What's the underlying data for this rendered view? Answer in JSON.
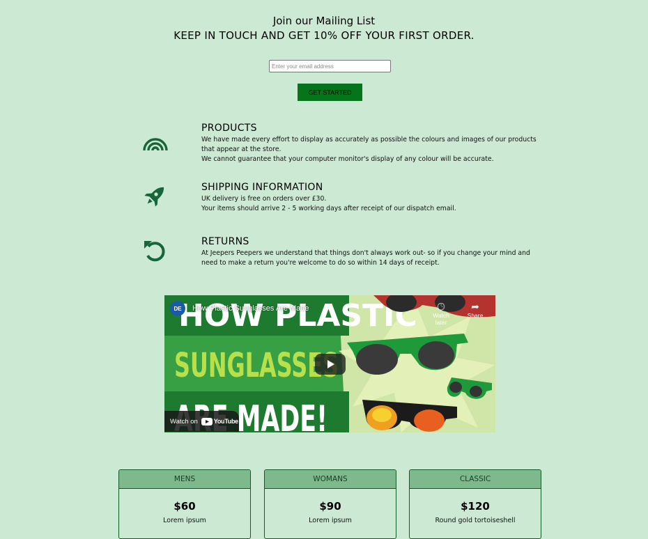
{
  "mailing": {
    "title": "Join our Mailing List",
    "subtitle": "KEEP IN TOUCH AND GET 10% OFF YOUR FIRST ORDER.",
    "email_placeholder": "Enter your email address",
    "button_label": "GET STARTED"
  },
  "info": [
    {
      "icon": "rainbow-icon",
      "title": "PRODUCTS",
      "lines": [
        "We have made every effort to display as accurately as possible the colours and images of our products that appear at the store.",
        "We cannot guarantee that your computer monitor's display of any colour will be accurate."
      ]
    },
    {
      "icon": "rocket-icon",
      "title": "SHIPPING INFORMATION",
      "lines": [
        "UK delivery is free on orders over £30.",
        "Your items should arrive 2 - 5 working days after receipt of our dispatch email."
      ]
    },
    {
      "icon": "undo-arrow-icon",
      "title": "RETURNS",
      "lines": [
        "At Jeepers Peepers we understand that things don't always work out- so if you change your mind and need to make a return you're welcome to do so within 14 days of receipt."
      ]
    }
  ],
  "video": {
    "channel_badge": "DE",
    "title": "How Plastic Sunglasses Are Made",
    "thumb_line1": "HOW PLASTIC",
    "thumb_line2": "SUNGLASSES",
    "thumb_line3": "ARE MADE!",
    "watch_later": "Watch later",
    "share": "Share",
    "watch_on": "Watch on",
    "youtube": "YouTube"
  },
  "cards": [
    {
      "category": "MENS",
      "price": "$60",
      "desc": "Lorem ipsum"
    },
    {
      "category": "WOMANS",
      "price": "$90",
      "desc": "Lorem ipsum"
    },
    {
      "category": "CLASSIC",
      "price": "$120",
      "desc": "Round gold tortoiseshell"
    }
  ],
  "colors": {
    "background": "#cbe9d3",
    "accent": "#05741b",
    "icon": "#16663a",
    "card_header": "#7db98c"
  }
}
